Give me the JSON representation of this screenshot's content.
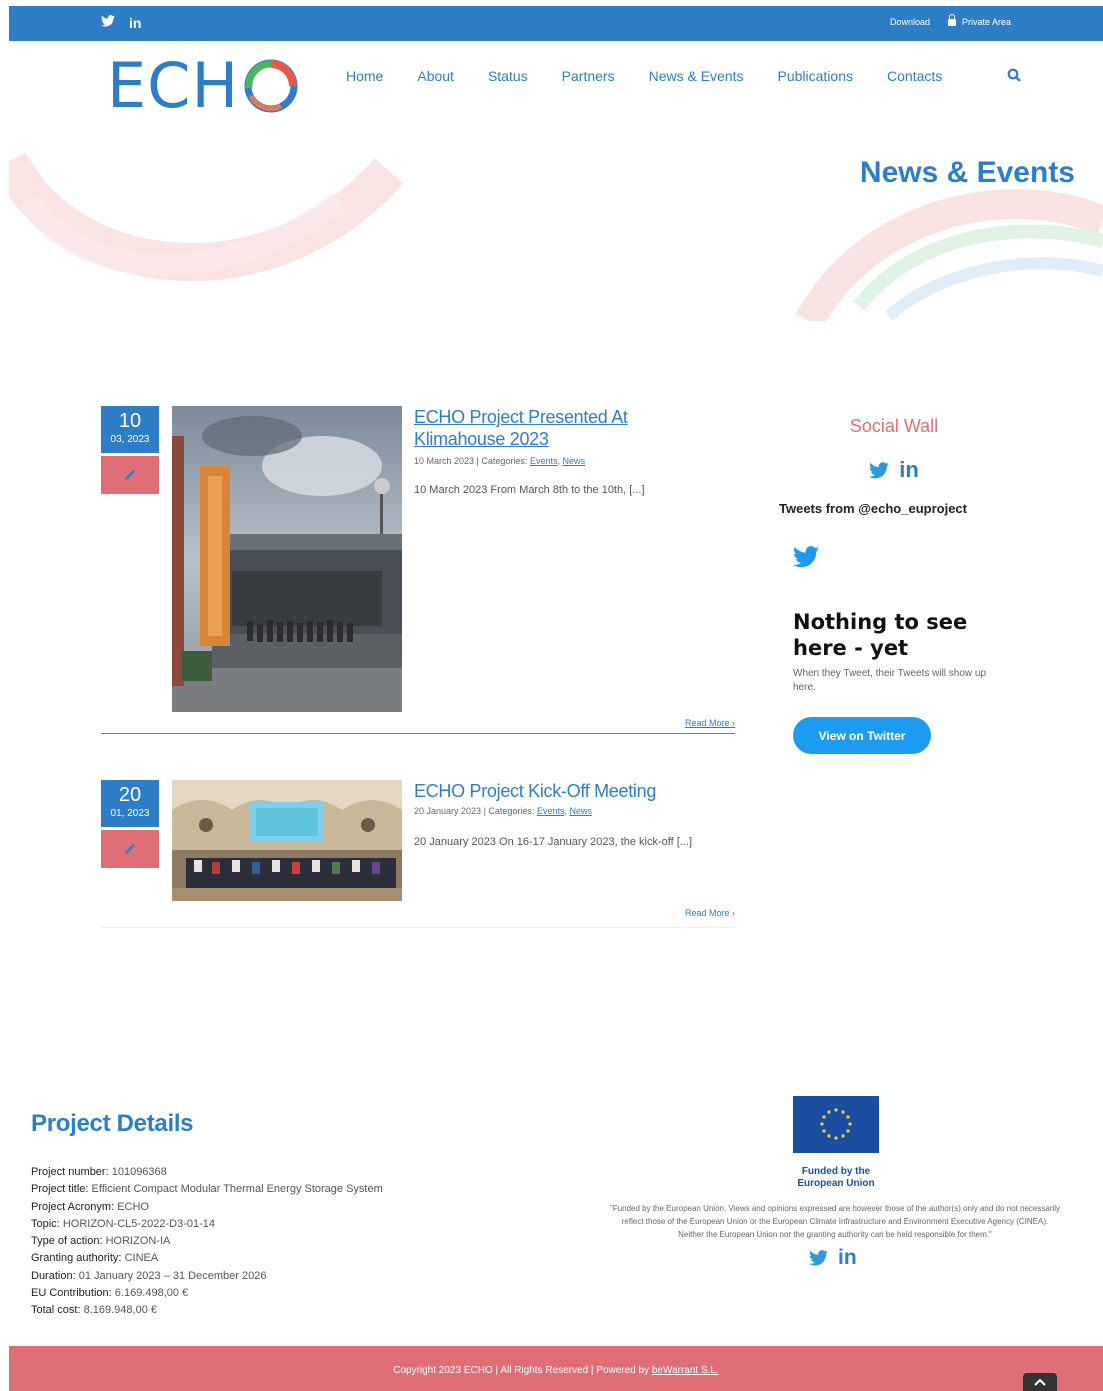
{
  "topbar": {
    "twitter_icon": "twitter-icon",
    "linkedin_label": "in",
    "download_label": "Download",
    "private_area_label": "Private Area"
  },
  "header": {
    "logo_text": "ECH",
    "nav": [
      "Home",
      "About",
      "Status",
      "Partners",
      "News & Events",
      "Publications",
      "Contacts"
    ],
    "active_nav": "News & Events"
  },
  "hero": {
    "title": "News & Events"
  },
  "posts": [
    {
      "day": "10",
      "month_year": "03, 2023",
      "title_line1": "ECHO Project Presented At",
      "title_line2": "Klimahouse 2023",
      "date": "10 March 2023",
      "categories_label": "Categories:",
      "cat1": "Events",
      "cat2": "News",
      "excerpt": "10 March 2023 From March 8th to the 10th, [...]",
      "read_more": "Read More"
    },
    {
      "day": "20",
      "month_year": "01, 2023",
      "title": "ECHO Project Kick-Off Meeting",
      "date": "20 January 2023",
      "categories_label": "Categories:",
      "cat1": "Events",
      "cat2": "News",
      "excerpt": "20 January 2023 On 16-17 January 2023, the kick-off [...]",
      "read_more": "Read More"
    }
  ],
  "sidebar": {
    "title": "Social Wall",
    "linkedin_label": "in",
    "tweets_from": "Tweets from @echo_euproject",
    "nothing_line1": "Nothing to see",
    "nothing_line2": "here - yet",
    "nothing_sub": "When they Tweet, their Tweets will show up here.",
    "button": "View on Twitter"
  },
  "project": {
    "title": "Project Details",
    "items": [
      {
        "k": "Project number:",
        "v": "101096368"
      },
      {
        "k": "Project title:",
        "v": "Efficient Compact Modular Thermal Energy Storage System"
      },
      {
        "k": "Project Acronym:",
        "v": "ECHO"
      },
      {
        "k": "Topic:",
        "v": "HORIZON-CL5-2022-D3-01-14"
      },
      {
        "k": "Type of action:",
        "v": "HORIZON-IA"
      },
      {
        "k": "Granting authority:",
        "v": "CINEA"
      },
      {
        "k": "Duration:",
        "v": "01 January 2023 – 31 December 2026"
      },
      {
        "k": "EU Contribution:",
        "v": "6.169.498,00 €"
      },
      {
        "k": "Total cost:",
        "v": "8.169.948,00 €"
      }
    ]
  },
  "eu": {
    "caption_line1": "Funded by the",
    "caption_line2": "European Union",
    "disclaimer_line1": "\"Funded by the European Union. Views and opinions expressed are however those of the author(s) only and do not necessarily",
    "disclaimer_line2": "reflect those of the European Union or the European Climate Infrastructure and Environment Executive Agency (CINEA).",
    "disclaimer_line3": "Neither the European Union nor the granting authority can be held responsible for them.\"",
    "linkedin_label": "in"
  },
  "footer": {
    "copyright": "Copyright 2023 ECHO | All Rights Reserved | Powered by ",
    "powered_by": "beWarrant S.L."
  },
  "colors": {
    "brand_blue": "#2e7dc7",
    "accent_red": "#df6e77",
    "twitter_blue": "#1d9bf0"
  }
}
